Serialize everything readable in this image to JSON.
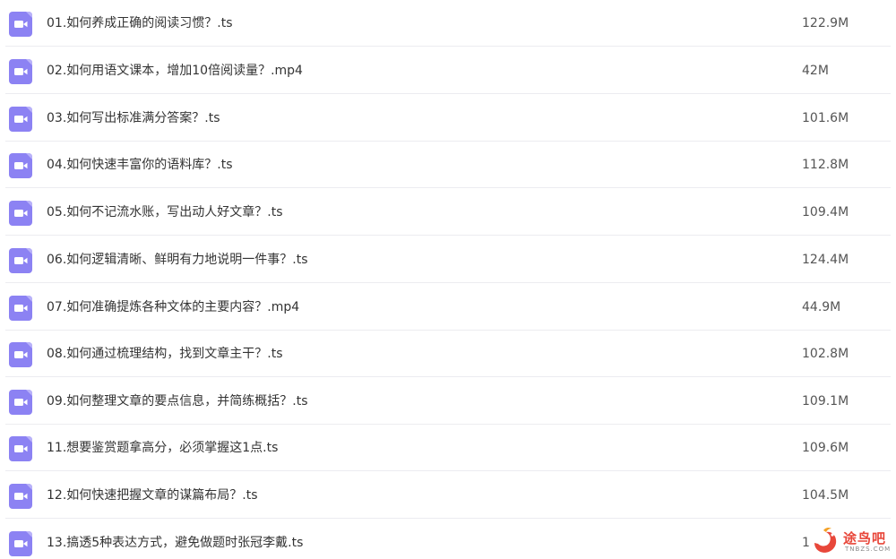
{
  "files": [
    {
      "name": "01.如何养成正确的阅读习惯？.ts",
      "size": "122.9M",
      "icon": "video-file-icon"
    },
    {
      "name": "02.如何用语文课本，增加10倍阅读量？.mp4",
      "size": "42M",
      "icon": "video-file-icon"
    },
    {
      "name": "03.如何写出标准满分答案？.ts",
      "size": "101.6M",
      "icon": "video-file-icon"
    },
    {
      "name": "04.如何快速丰富你的语料库？.ts",
      "size": "112.8M",
      "icon": "video-file-icon"
    },
    {
      "name": "05.如何不记流水账，写出动人好文章？.ts",
      "size": "109.4M",
      "icon": "video-file-icon"
    },
    {
      "name": "06.如何逻辑清晰、鲜明有力地说明一件事？.ts",
      "size": "124.4M",
      "icon": "video-file-icon"
    },
    {
      "name": "07.如何准确提炼各种文体的主要内容？.mp4",
      "size": "44.9M",
      "icon": "video-file-icon"
    },
    {
      "name": "08.如何通过梳理结构，找到文章主干？.ts",
      "size": "102.8M",
      "icon": "video-file-icon"
    },
    {
      "name": "09.如何整理文章的要点信息，并简练概括？.ts",
      "size": "109.1M",
      "icon": "video-file-icon"
    },
    {
      "name": "11.想要鉴赏题拿高分，必须掌握这1点.ts",
      "size": "109.6M",
      "icon": "video-file-icon"
    },
    {
      "name": "12.如何快速把握文章的谋篇布局？.ts",
      "size": "104.5M",
      "icon": "video-file-icon"
    },
    {
      "name": "13.搞透5种表达方式，避免做题时张冠李戴.ts",
      "size": "1",
      "icon": "video-file-icon"
    }
  ],
  "watermark": {
    "title": "途鸟吧",
    "subtitle": "TNBZS.COM"
  },
  "colors": {
    "icon_bg": "#8c82f3",
    "text": "#333333",
    "divider": "#ececf0",
    "watermark": "#e8473a"
  }
}
